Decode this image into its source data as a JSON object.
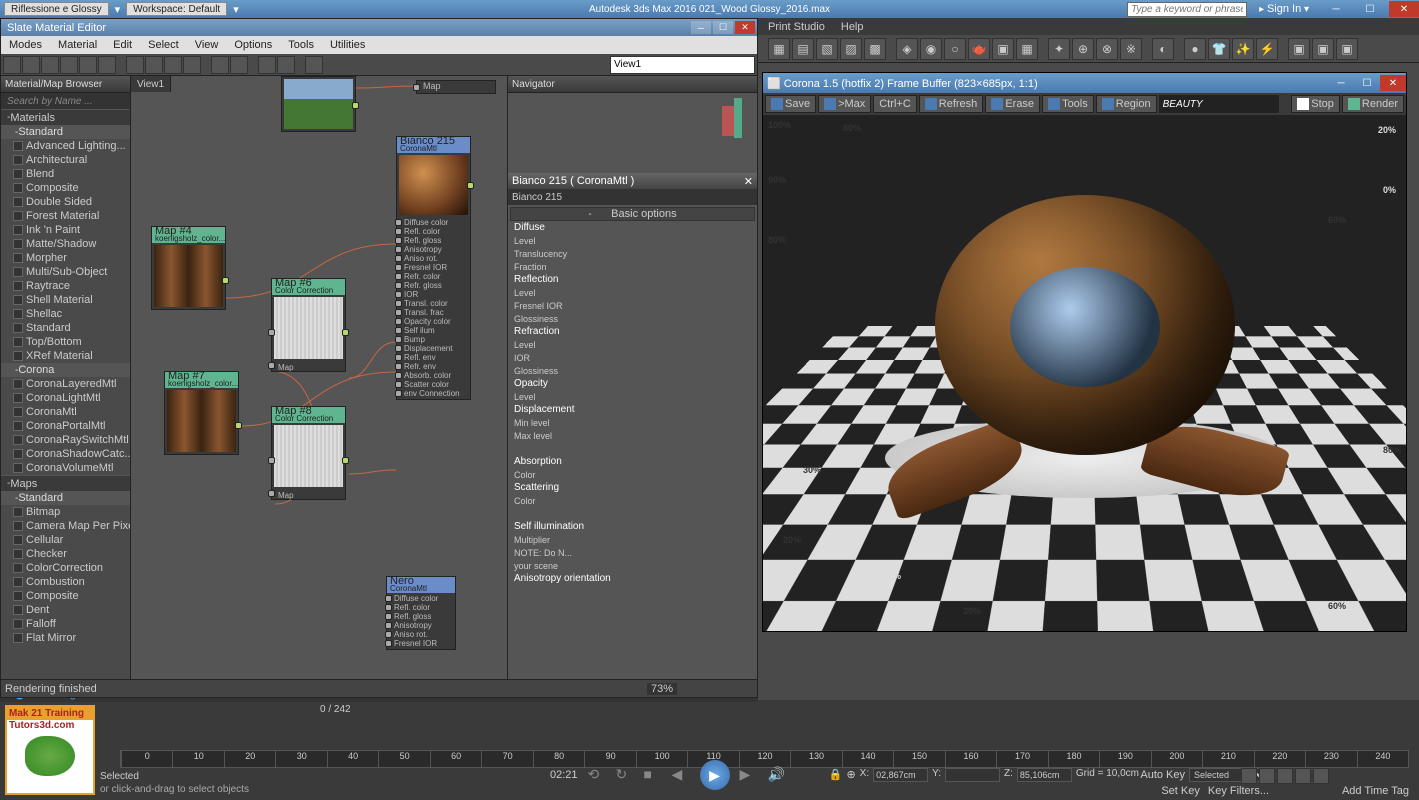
{
  "app": {
    "scene_title": "Riflessione e Glossy",
    "workspace_label": "Workspace: Default",
    "title_center": "Autodesk 3ds Max 2016   021_Wood Glossy_2016.max",
    "search_placeholder": "Type a keyword or phrase",
    "signin": "Sign In"
  },
  "menu": {
    "items": [
      "Print Studio",
      "Help"
    ]
  },
  "slate": {
    "title": "Slate Material Editor",
    "menu": [
      "Modes",
      "Material",
      "Edit",
      "Select",
      "View",
      "Options",
      "Tools",
      "Utilities"
    ],
    "view_combo": "View1",
    "view_tab": "View1",
    "browser": {
      "header": "Material/Map Browser",
      "search_placeholder": "Search by Name ...",
      "materials_hdr": "Materials",
      "standard_label": "Standard",
      "standard": [
        "Advanced Lighting...",
        "Architectural",
        "Blend",
        "Composite",
        "Double Sided",
        "Forest Material",
        "Ink 'n Paint",
        "Matte/Shadow",
        "Morpher",
        "Multi/Sub-Object",
        "Raytrace",
        "Shell Material",
        "Shellac",
        "Standard",
        "Top/Bottom",
        "XRef Material"
      ],
      "corona_label": "Corona",
      "corona": [
        "CoronaLayeredMtl",
        "CoronaLightMtl",
        "CoronaMtl",
        "CoronaPortalMtl",
        "CoronaRaySwitchMtl",
        "CoronaShadowCatc...",
        "CoronaVolumeMtl"
      ],
      "maps_hdr": "Maps",
      "maps_standard_label": "Standard",
      "maps": [
        "Bitmap",
        "Camera Map Per Pixel",
        "Cellular",
        "Checker",
        "ColorCorrection",
        "Combustion",
        "Composite",
        "Dent",
        "Falloff",
        "Flat Mirror"
      ]
    },
    "nodes": {
      "env": {
        "title": "",
        "sub": "Map"
      },
      "map4": {
        "title": "Map #4",
        "sub": "koenigsholz_color..."
      },
      "map7": {
        "title": "Map #7",
        "sub": "koenigsholz_color..."
      },
      "map6": {
        "title": "Map #6",
        "sub": "Color Correction"
      },
      "map8": {
        "title": "Map #8",
        "sub": "Color Correction"
      },
      "bianco": {
        "title": "Bianco 215",
        "sub": "CoronaMtl",
        "map_label": "Map",
        "slots": [
          "Diffuse color",
          "Refl. color",
          "Refl. gloss",
          "Anisotropy",
          "Aniso rot.",
          "Fresnel IOR",
          "Refr. color",
          "Refr. gloss",
          "IOR",
          "Transl. color",
          "Transl. frac",
          "Opacity color",
          "Self ilum",
          "Bump",
          "Displacement",
          "Refl. env",
          "Refr. env",
          "Absorb. color",
          "Scatter color",
          "env Connection"
        ]
      },
      "nero": {
        "title": "Nero",
        "sub": "CoronaMtl",
        "slots": [
          "Diffuse color",
          "Refl. color",
          "Refl. gloss",
          "Anisotropy",
          "Aniso rot.",
          "Fresnel IOR"
        ]
      }
    },
    "navigator_hdr": "Navigator",
    "params": {
      "header": "Bianco 215  ( CoronaMtl )",
      "name": "Bianco 215",
      "rollout": "Basic options",
      "rows": [
        "Diffuse",
        "Level",
        "Translucency",
        "Fraction",
        "Reflection",
        "Level",
        "Fresnel IOR",
        "Glossiness",
        "Refraction",
        "Level",
        "IOR",
        "Glossiness",
        "Opacity",
        "Level",
        "Displacement",
        "Min level",
        "Max level",
        "",
        "Absorption",
        "Color",
        "Scattering",
        "Color",
        "",
        "Self illumination",
        "Multiplier",
        "NOTE: Do N...",
        "your scene",
        "Anisotropy orientation"
      ],
      "sections": [
        0,
        4,
        8,
        12,
        14,
        18,
        20,
        23,
        27
      ]
    },
    "status": "Rendering finished",
    "zoom": "73%"
  },
  "fb": {
    "title": "Corona 1.5 (hotfix 2) Frame Buffer (823×685px, 1:1)",
    "btns": {
      "save": "Save",
      "max": ">Max",
      "ctrlc": "Ctrl+C",
      "refresh": "Refresh",
      "erase": "Erase",
      "tools": "Tools",
      "region": "Region",
      "stop": "Stop",
      "render": "Render"
    },
    "combo": "BEAUTY"
  },
  "rend_status": "Rendering finished",
  "bottom": {
    "frame_info": "0 / 242",
    "ruler": [
      "0",
      "10",
      "20",
      "30",
      "40",
      "50",
      "60",
      "70",
      "80",
      "90",
      "100",
      "110",
      "120",
      "130",
      "140",
      "150",
      "160",
      "170",
      "180",
      "190",
      "200",
      "210",
      "220",
      "230",
      "240"
    ],
    "status_selected": "Selected",
    "status_hint": "or click-and-drag to select objects",
    "time": "02:21",
    "x": "02,867cm",
    "y": "",
    "z": "85,106cm",
    "grid": "Grid = 10,0cm",
    "autokey": "Auto Key",
    "autokey_sel": "Selected",
    "setkey": "Set Key",
    "keyfilters": "Key Filters...",
    "addtag": "Add Time Tag"
  },
  "logo": {
    "line1": "Mak 21 Training",
    "line2": "Tutors3d.com"
  }
}
